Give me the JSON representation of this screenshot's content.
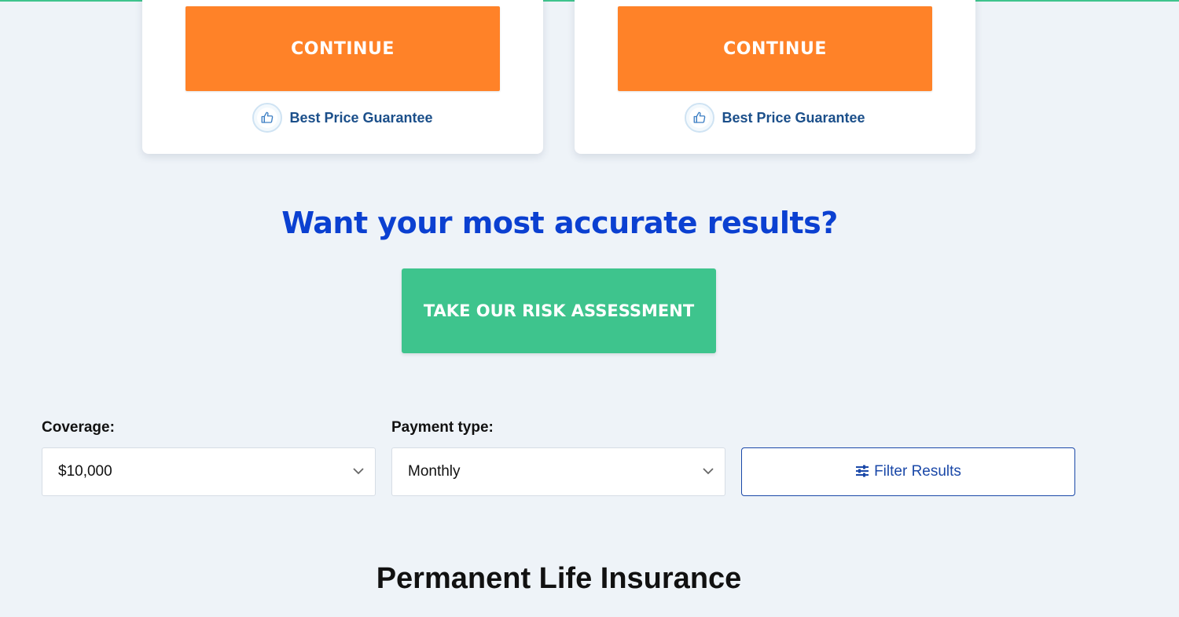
{
  "cards": [
    {
      "continue_label": "CONTINUE",
      "guarantee_label": "Best Price Guarantee"
    },
    {
      "continue_label": "CONTINUE",
      "guarantee_label": "Best Price Guarantee"
    }
  ],
  "assessment": {
    "headline": "Want your most accurate results?",
    "button_label": "TAKE OUR RISK ASSESSMENT"
  },
  "filters": {
    "coverage": {
      "label": "Coverage:",
      "value": "$10,000"
    },
    "payment": {
      "label": "Payment type:",
      "value": "Monthly"
    },
    "filter_button_label": "Filter Results"
  },
  "section": {
    "title": "Permanent Life Insurance"
  },
  "colors": {
    "continue": "#ff8228",
    "risk": "#3ec48d",
    "headline": "#0b40d1",
    "filter": "#1a48a8",
    "background": "#eef3f8"
  },
  "icons": {
    "guarantee": "thumbs-up-icon",
    "select_arrow": "chevron-down-icon",
    "filter": "sliders-icon"
  }
}
